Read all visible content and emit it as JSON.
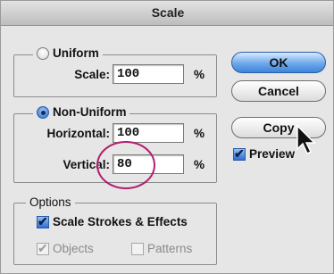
{
  "window": {
    "title": "Scale"
  },
  "uniform": {
    "label": "Uniform",
    "selected": false,
    "scale_label": "Scale:",
    "scale_value": "100",
    "unit": "%"
  },
  "non_uniform": {
    "label": "Non-Uniform",
    "selected": true,
    "horizontal_label": "Horizontal:",
    "horizontal_value": "100",
    "vertical_label": "Vertical:",
    "vertical_value": "80",
    "unit": "%"
  },
  "options": {
    "label": "Options",
    "scale_strokes": {
      "label": "Scale Strokes & Effects",
      "checked": true
    },
    "objects": {
      "label": "Objects",
      "checked": true,
      "enabled": false
    },
    "patterns": {
      "label": "Patterns",
      "checked": false,
      "enabled": false
    }
  },
  "buttons": {
    "ok": "OK",
    "cancel": "Cancel",
    "copy": "Copy"
  },
  "preview": {
    "label": "Preview",
    "checked": true
  },
  "annotation": {
    "color": "#b21e6e"
  },
  "icons": [
    "radio-icon",
    "checkbox-icon",
    "arrow-cursor-icon"
  ]
}
